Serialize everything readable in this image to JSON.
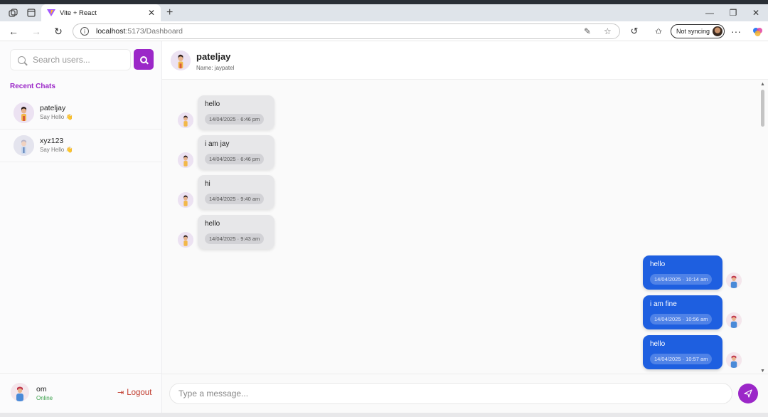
{
  "browser": {
    "tab_title": "Vite + React",
    "url_host": "localhost",
    "url_path": ":5173/Dashboard",
    "sync_label": "Not syncing"
  },
  "sidebar": {
    "search_placeholder": "Search users...",
    "recent_title": "Recent Chats",
    "chats": [
      {
        "name": "pateljay",
        "last": "Say Hello 👋"
      },
      {
        "name": "xyz123",
        "last": "Say Hello 👋"
      }
    ],
    "me": {
      "name": "om",
      "status": "Online",
      "logout_label": "Logout"
    }
  },
  "chat": {
    "name": "pateljay",
    "subtitle": "Name: jaypatel",
    "messages": [
      {
        "dir": "in",
        "text": "hello",
        "time": "14/04/2025 · 6:46 pm"
      },
      {
        "dir": "in",
        "text": "i am jay",
        "time": "14/04/2025 · 6:46 pm"
      },
      {
        "dir": "in",
        "text": "hi",
        "time": "14/04/2025 · 9:40 am"
      },
      {
        "dir": "in",
        "text": "hello",
        "time": "14/04/2025 · 9:43 am"
      },
      {
        "dir": "out",
        "text": "hello",
        "time": "14/04/2025 · 10:14 am"
      },
      {
        "dir": "out",
        "text": "i am fine",
        "time": "14/04/2025 · 10:56 am"
      },
      {
        "dir": "out",
        "text": "hello",
        "time": "14/04/2025 · 10:57 am"
      }
    ],
    "composer_placeholder": "Type a message..."
  },
  "colors": {
    "accent": "#9b27c8",
    "outgoing_bubble": "#1e5fe0",
    "incoming_bubble": "#e7e7e9",
    "logout": "#c0392b",
    "online": "#3aa04a"
  }
}
